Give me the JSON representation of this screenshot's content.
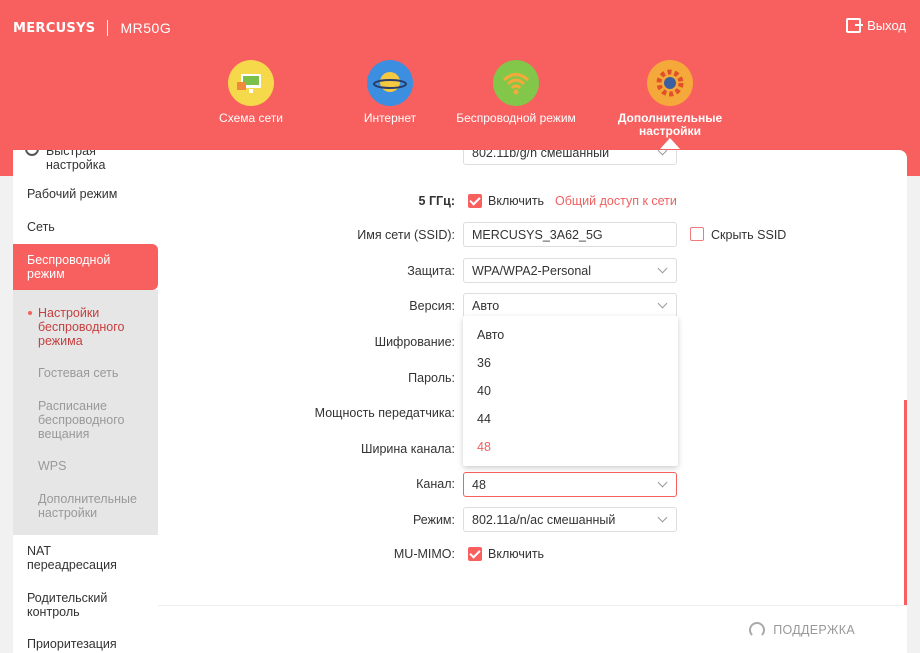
{
  "header": {
    "brand": "MERCUSYS",
    "model": "MR50G",
    "logout_label": "Выход"
  },
  "nav": [
    {
      "label": "Схема сети",
      "icon": "network-map-icon"
    },
    {
      "label": "Интернет",
      "icon": "planet-icon"
    },
    {
      "label": "Беспроводной режим",
      "icon": "wifi-icon"
    },
    {
      "label": "Дополнительные настройки",
      "icon": "gear-icon",
      "active": true
    }
  ],
  "sidebar": {
    "items": [
      {
        "label": "Быстрая настройка"
      },
      {
        "label": "Рабочий режим"
      },
      {
        "label": "Сеть"
      },
      {
        "label": "Беспроводной режим",
        "active": true
      },
      {
        "label": "NAT переадресация"
      },
      {
        "label": "Родительский контроль"
      },
      {
        "label": "Приоритезация"
      }
    ],
    "sub_items": [
      {
        "label": "Настройки беспроводного режима",
        "current": true
      },
      {
        "label": "Гостевая сеть"
      },
      {
        "label": "Расписание беспроводного вещания"
      },
      {
        "label": "WPS"
      },
      {
        "label": "Дополнительные настройки"
      }
    ]
  },
  "form": {
    "top_mode_value": "802.11b/g/n смешанный",
    "band_label": "5 ГГц:",
    "enable_label": "Включить",
    "share_link": "Общий доступ к сети",
    "ssid_label": "Имя сети (SSID):",
    "ssid_value": "MERCUSYS_3A62_5G",
    "hide_ssid_label": "Скрыть SSID",
    "security_label": "Защита:",
    "security_value": "WPA/WPA2-Personal",
    "version_label": "Версия:",
    "version_value": "Авто",
    "encryption_label": "Шифрование:",
    "password_label": "Пароль:",
    "power_label": "Мощность передатчика:",
    "width_label": "Ширина канала:",
    "channel_label": "Канал:",
    "channel_value": "48",
    "mode_label": "Режим:",
    "mode_value": "802.11a/n/ac смешанный",
    "mumimo_label": "MU-MIMO:",
    "mumimo_enable_label": "Включить"
  },
  "dropdown": {
    "options": [
      "Авто",
      "36",
      "40",
      "44",
      "48"
    ],
    "selected": "48"
  },
  "footer": {
    "support_label": "ПОДДЕРЖКА"
  },
  "colors": {
    "accent": "#f85f5f",
    "link": "#f06060"
  }
}
